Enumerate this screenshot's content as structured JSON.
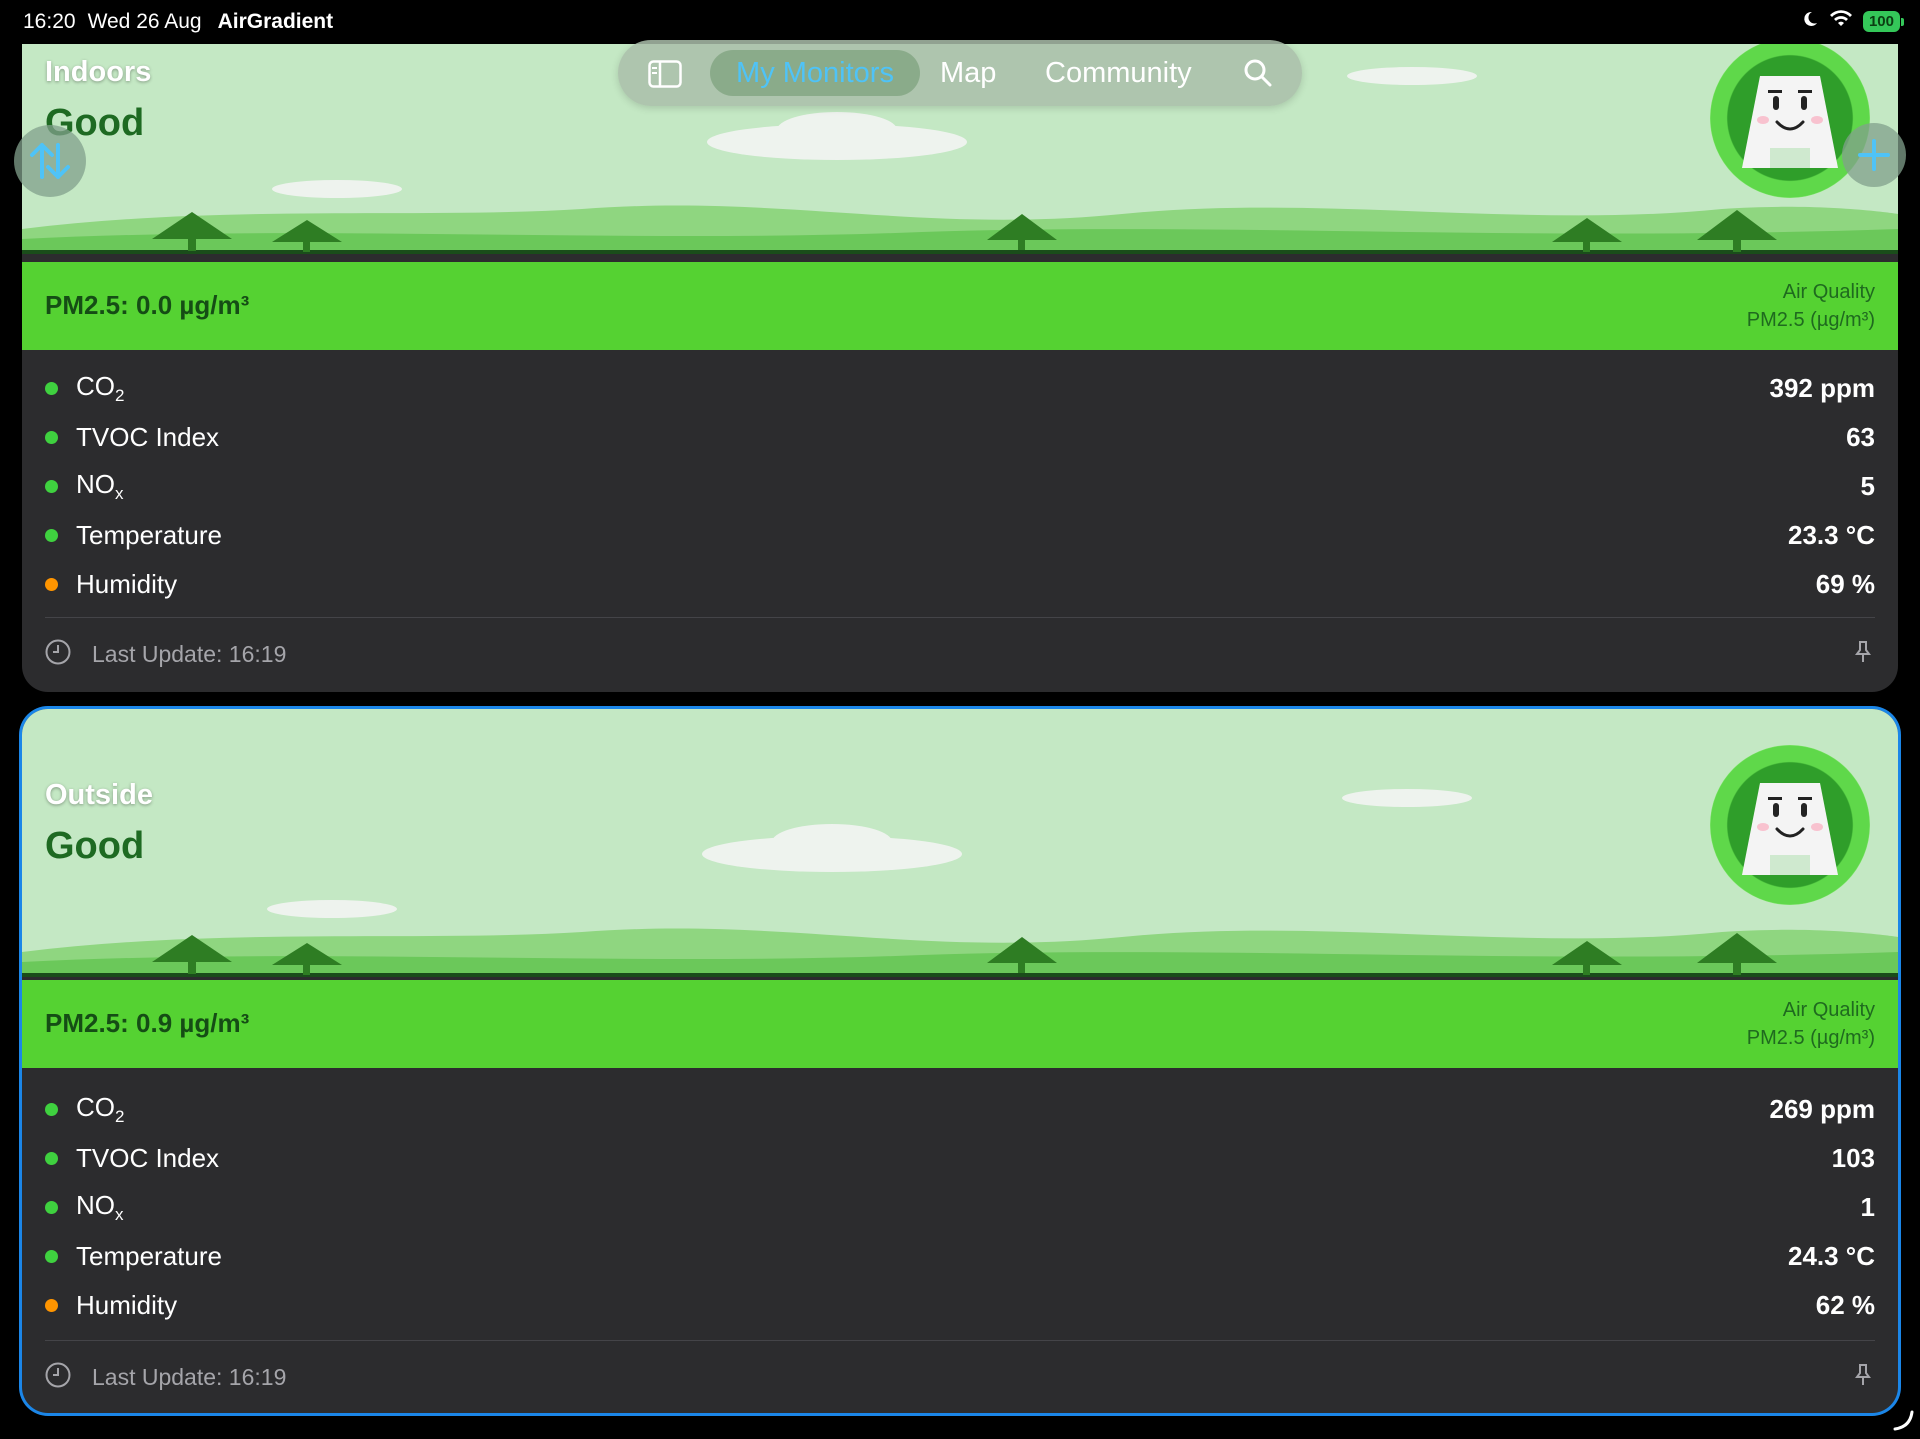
{
  "status_bar": {
    "time": "16:20",
    "date": "Wed 26 Aug",
    "app": "AirGradient",
    "battery": "100"
  },
  "nav": {
    "tabs": [
      {
        "label": "My Monitors"
      },
      {
        "label": "Map"
      },
      {
        "label": "Community"
      }
    ],
    "active_tab": "My Monitors",
    "accent_color": "#4fc3f7"
  },
  "monitors": [
    {
      "name": "Indoors",
      "status": "Good",
      "pm25": "PM2.5: 0.0 µg/m³",
      "legend_title": "Air Quality",
      "legend_unit": "PM2.5 (µg/m³)",
      "metrics": [
        {
          "label": "CO",
          "sub": "2",
          "value": "392 ppm",
          "color": "#3fd13f"
        },
        {
          "label": "TVOC Index",
          "sub": "",
          "value": "63",
          "color": "#3fd13f"
        },
        {
          "label": "NO",
          "sub": "x",
          "value": "5",
          "color": "#3fd13f"
        },
        {
          "label": "Temperature",
          "sub": "",
          "value": "23.3 °C",
          "color": "#3fd13f"
        },
        {
          "label": "Humidity",
          "sub": "",
          "value": "69 %",
          "color": "#ff9500"
        }
      ],
      "last_update": "Last Update: 16:19"
    },
    {
      "name": "Outside",
      "status": "Good",
      "pm25": "PM2.5: 0.9 µg/m³",
      "legend_title": "Air Quality",
      "legend_unit": "PM2.5 (µg/m³)",
      "metrics": [
        {
          "label": "CO",
          "sub": "2",
          "value": "269 ppm",
          "color": "#3fd13f"
        },
        {
          "label": "TVOC Index",
          "sub": "",
          "value": "103",
          "color": "#3fd13f"
        },
        {
          "label": "NO",
          "sub": "x",
          "value": "1",
          "color": "#3fd13f"
        },
        {
          "label": "Temperature",
          "sub": "",
          "value": "24.3 °C",
          "color": "#3fd13f"
        },
        {
          "label": "Humidity",
          "sub": "",
          "value": "62 %",
          "color": "#ff9500"
        }
      ],
      "last_update": "Last Update: 16:19"
    }
  ],
  "colors": {
    "good_band": "#55d232",
    "selected_border": "#1b86e8",
    "card_bg": "#2c2c2e"
  }
}
